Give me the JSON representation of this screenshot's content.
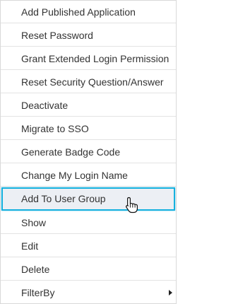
{
  "menu": {
    "items": [
      {
        "label": "Add Published Application"
      },
      {
        "label": "Reset Password"
      },
      {
        "label": "Grant Extended Login Permission"
      },
      {
        "label": "Reset Security Question/Answer"
      },
      {
        "label": "Deactivate"
      },
      {
        "label": "Migrate to SSO"
      },
      {
        "label": "Generate Badge Code"
      },
      {
        "label": "Change My Login Name"
      },
      {
        "label": "Add To User Group",
        "highlighted": true
      },
      {
        "label": "Show"
      },
      {
        "label": "Edit"
      },
      {
        "label": "Delete"
      },
      {
        "label": "FilterBy",
        "submenu_icon": "chevron-right-icon"
      }
    ]
  },
  "cursor_icon": "hand-pointer-icon",
  "colors": {
    "highlight_border": "#16b0de",
    "highlight_background": "#eceff4",
    "text": "#333333"
  }
}
